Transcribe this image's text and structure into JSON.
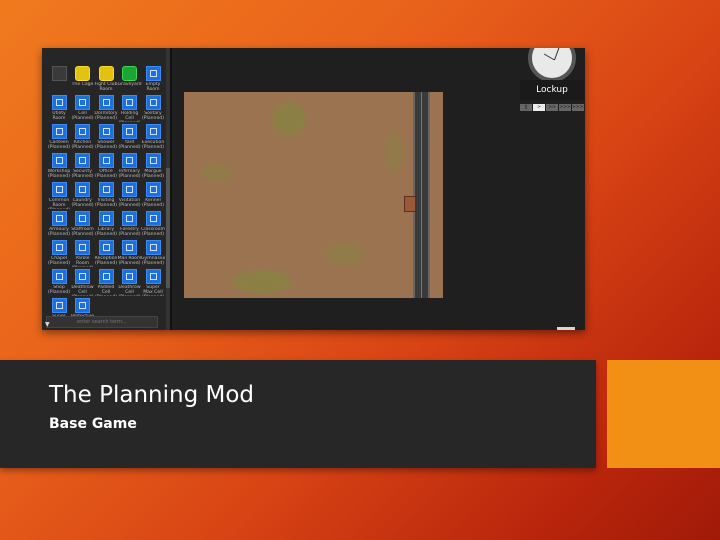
{
  "slide": {
    "title": "The Planning Mod",
    "subtitle": "Base Game",
    "colors": {
      "accent_box": "#f19015",
      "title_band": "#272727"
    }
  },
  "screenshot": {
    "room_grid": [
      {
        "label": "",
        "style": "dark",
        "icon": "room-icon"
      },
      {
        "label": "The Cage",
        "style": "yellow",
        "icon": "cage-icon"
      },
      {
        "label": "Fight Club Room",
        "style": "yellow",
        "icon": "fight-club-icon"
      },
      {
        "label": "Graveyard",
        "style": "green",
        "icon": "graveyard-icon"
      },
      {
        "label": "Empty Room",
        "style": "blue",
        "icon": "room-icon"
      },
      {
        "label": "Utility Room",
        "style": "blue",
        "icon": "room-icon"
      },
      {
        "label": "Cell (Planned)",
        "style": "blue",
        "icon": "room-icon"
      },
      {
        "label": "Dormitory (Planned)",
        "style": "blue",
        "icon": "room-icon"
      },
      {
        "label": "Holding Cell (Planned)",
        "style": "blue",
        "icon": "room-icon"
      },
      {
        "label": "Solitary (Planned)",
        "style": "blue",
        "icon": "room-icon"
      },
      {
        "label": "Canteen (Planned)",
        "style": "blue",
        "icon": "room-icon"
      },
      {
        "label": "Kitchen (Planned)",
        "style": "blue",
        "icon": "room-icon"
      },
      {
        "label": "Shower (Planned)",
        "style": "blue",
        "icon": "room-icon"
      },
      {
        "label": "Yard (Planned)",
        "style": "blue",
        "icon": "room-icon"
      },
      {
        "label": "Execution (Planned)",
        "style": "blue",
        "icon": "room-icon"
      },
      {
        "label": "Workshop (Planned)",
        "style": "blue",
        "icon": "room-icon"
      },
      {
        "label": "Security (Planned)",
        "style": "blue",
        "icon": "room-icon"
      },
      {
        "label": "Office (Planned)",
        "style": "blue",
        "icon": "room-icon"
      },
      {
        "label": "Infirmary (Planned)",
        "style": "blue",
        "icon": "room-icon"
      },
      {
        "label": "Morgue (Planned)",
        "style": "blue",
        "icon": "room-icon"
      },
      {
        "label": "Common Room (Planned)",
        "style": "blue",
        "icon": "room-icon"
      },
      {
        "label": "Laundry (Planned)",
        "style": "blue",
        "icon": "room-icon"
      },
      {
        "label": "Visiting (Planned)",
        "style": "blue",
        "icon": "room-icon"
      },
      {
        "label": "Visitation (Planned)",
        "style": "blue",
        "icon": "room-icon"
      },
      {
        "label": "Kennel (Planned)",
        "style": "blue",
        "icon": "room-icon"
      },
      {
        "label": "Armoury (Planned)",
        "style": "blue",
        "icon": "room-icon"
      },
      {
        "label": "Staffroom (Planned)",
        "style": "blue",
        "icon": "room-icon"
      },
      {
        "label": "Library (Planned)",
        "style": "blue",
        "icon": "room-icon"
      },
      {
        "label": "Forestry (Planned)",
        "style": "blue",
        "icon": "room-icon"
      },
      {
        "label": "Classroom (Planned)",
        "style": "blue",
        "icon": "room-icon"
      },
      {
        "label": "Chapel (Planned)",
        "style": "blue",
        "icon": "room-icon"
      },
      {
        "label": "Parole Room (Planned)",
        "style": "blue",
        "icon": "room-icon"
      },
      {
        "label": "Reception (Planned)",
        "style": "blue",
        "icon": "room-icon"
      },
      {
        "label": "Mail Room (Planned)",
        "style": "blue",
        "icon": "room-icon"
      },
      {
        "label": "Gymnasium (Planned)",
        "style": "blue",
        "icon": "room-icon"
      },
      {
        "label": "Shop (Planned)",
        "style": "blue",
        "icon": "room-icon"
      },
      {
        "label": "Deathrow Cell (Planned)",
        "style": "blue",
        "icon": "room-icon"
      },
      {
        "label": "Padded Cell (Planned)",
        "style": "blue",
        "icon": "room-icon"
      },
      {
        "label": "Deathrow Cell (Planned)",
        "style": "blue",
        "icon": "room-icon"
      },
      {
        "label": "Super Max Cell (Planned)",
        "style": "blue",
        "icon": "room-icon"
      },
      {
        "label": "Super Max Cell (Planned)",
        "style": "blue",
        "icon": "room-icon"
      },
      {
        "label": "Protective Custody (Planned)",
        "style": "blue",
        "icon": "room-icon"
      }
    ],
    "search_placeholder": "enter search term...",
    "regime_label": "Lockup",
    "speed_controls": [
      "||",
      ">",
      ">>",
      ">>>",
      ">>>>"
    ],
    "active_speed_index": 1
  }
}
